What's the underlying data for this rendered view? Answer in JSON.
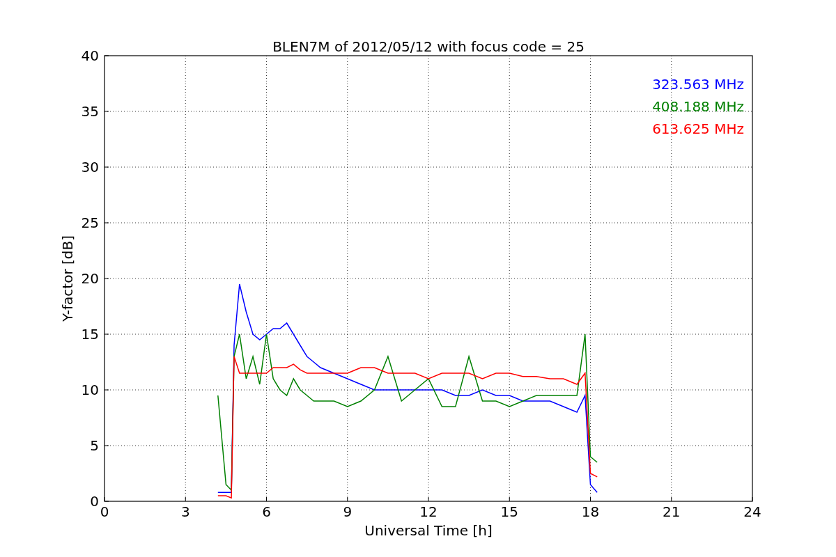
{
  "chart_data": {
    "type": "line",
    "title": "BLEN7M of 2012/05/12 with focus code = 25",
    "xlabel": "Universal Time [h]",
    "ylabel": "Y-factor [dB]",
    "x": [
      4.2,
      4.5,
      4.7,
      4.8,
      5.0,
      5.25,
      5.5,
      5.75,
      6.0,
      6.25,
      6.5,
      6.75,
      7.0,
      7.25,
      7.5,
      7.75,
      8.0,
      8.5,
      9,
      9.5,
      10,
      10.5,
      11,
      11.5,
      12,
      12.5,
      13,
      13.5,
      14,
      14.5,
      15,
      15.5,
      16,
      16.5,
      17,
      17.5,
      17.8,
      18.0,
      18.25
    ],
    "series": [
      {
        "name": "323.563 MHz",
        "color": "#0000ff",
        "values": [
          0.8,
          0.8,
          0.8,
          14,
          19.5,
          17,
          15,
          14.5,
          15,
          15.5,
          15.5,
          16,
          15,
          14,
          13,
          12.5,
          12,
          11.5,
          11,
          10.5,
          10,
          10,
          10,
          10,
          10,
          10,
          9.5,
          9.5,
          10,
          9.5,
          9.5,
          9,
          9,
          9,
          8.5,
          8,
          9.5,
          1.5,
          0.8
        ]
      },
      {
        "name": "408.188 MHz",
        "color": "#008000",
        "values": [
          9.5,
          1.5,
          1.0,
          13,
          15,
          11,
          13,
          10.5,
          15,
          11,
          10,
          9.5,
          11,
          10,
          9.5,
          9,
          9,
          9,
          8.5,
          9,
          10,
          13,
          9,
          10,
          11,
          8.5,
          8.5,
          13,
          9,
          9,
          8.5,
          9,
          9.5,
          9.5,
          9.5,
          9.5,
          15,
          4,
          3.5
        ]
      },
      {
        "name": "613.625 MHz",
        "color": "#ff0000",
        "values": [
          0.5,
          0.5,
          0.3,
          13,
          11.5,
          11.5,
          11.5,
          11.5,
          11.5,
          12,
          12,
          12,
          12.3,
          11.8,
          11.5,
          11.5,
          11.5,
          11.5,
          11.5,
          12,
          12,
          11.5,
          11.5,
          11.5,
          11,
          11.5,
          11.5,
          11.5,
          11,
          11.5,
          11.5,
          11.2,
          11.2,
          11,
          11,
          10.5,
          11.5,
          2.5,
          2.2
        ]
      }
    ],
    "grid": true,
    "xlim": [
      0,
      24
    ],
    "ylim": [
      0,
      40
    ],
    "xticks": [
      0,
      3,
      6,
      9,
      12,
      15,
      18,
      21,
      24
    ],
    "yticks": [
      0,
      5,
      10,
      15,
      20,
      25,
      30,
      35,
      40
    ]
  }
}
